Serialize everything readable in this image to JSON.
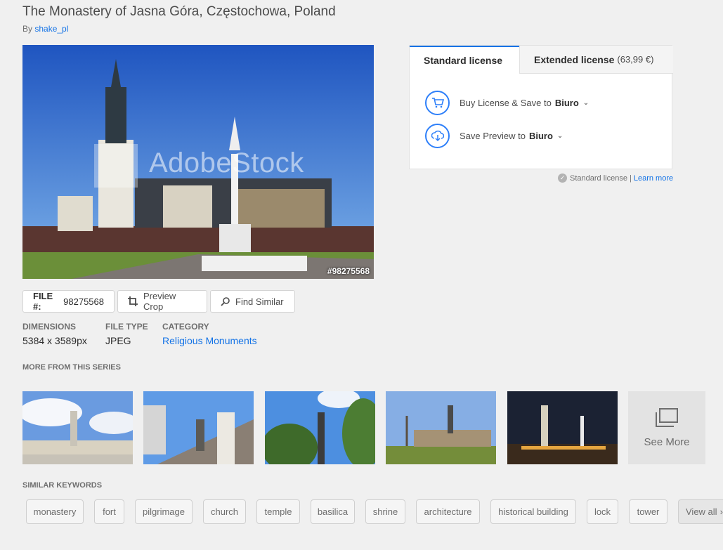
{
  "header": {
    "title": "The Monastery of Jasna Góra, Częstochowa, Poland",
    "by_prefix": "By",
    "author": "shake_pl"
  },
  "hero": {
    "watermark": "AdobeStock",
    "file_id_overlay": "#98275568"
  },
  "tools": {
    "file_label": "FILE #:",
    "file_number": "98275568",
    "preview_crop": "Preview Crop",
    "find_similar": "Find Similar"
  },
  "meta": {
    "dimensions_label": "DIMENSIONS",
    "dimensions_value": "5384 x 3589px",
    "filetype_label": "FILE TYPE",
    "filetype_value": "JPEG",
    "category_label": "CATEGORY",
    "category_value": "Religious Monuments"
  },
  "series": {
    "heading": "MORE FROM THIS SERIES",
    "see_more": "See More"
  },
  "keywords": {
    "heading": "SIMILAR KEYWORDS",
    "items": [
      "monastery",
      "fort",
      "pilgrimage",
      "church",
      "temple",
      "basilica",
      "shrine",
      "architecture",
      "historical building",
      "lock",
      "tower",
      "View all"
    ]
  },
  "license": {
    "tab_standard": "Standard license",
    "tab_extended": "Extended license",
    "extended_price": "(63,99 €)",
    "buy_text": "Buy License & Save to",
    "buy_target": "Biuro",
    "preview_text": "Save Preview to",
    "preview_target": "Biuro",
    "note_text": "Standard license |",
    "learn_more": "Learn more"
  },
  "colors": {
    "accent": "#1473e6",
    "background": "#f0f0f0"
  }
}
